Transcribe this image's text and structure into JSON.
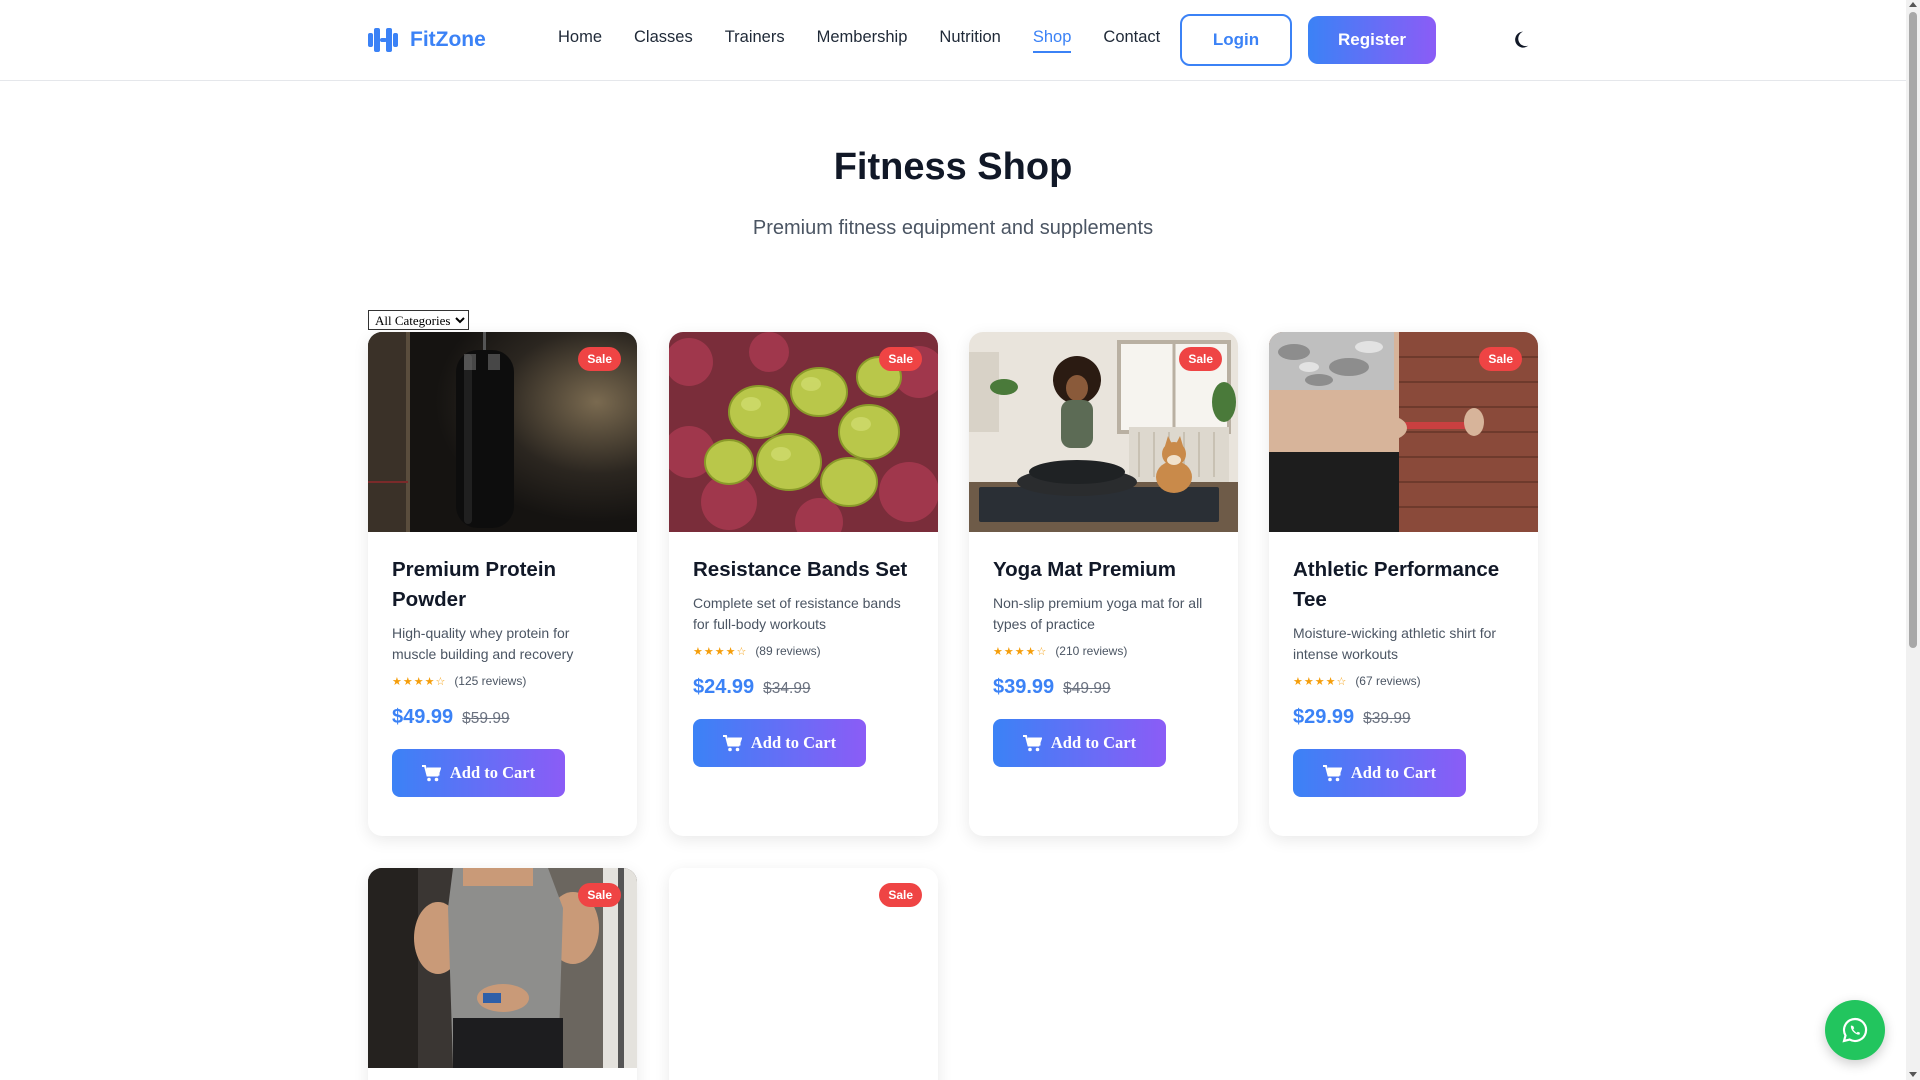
{
  "header": {
    "logo_text": "FitZone",
    "nav": [
      {
        "label": "Home",
        "active": false
      },
      {
        "label": "Classes",
        "active": false
      },
      {
        "label": "Trainers",
        "active": false
      },
      {
        "label": "Membership",
        "active": false
      },
      {
        "label": "Nutrition",
        "active": false
      },
      {
        "label": "Shop",
        "active": true
      },
      {
        "label": "Contact",
        "active": false
      }
    ],
    "login_label": "Login",
    "register_label": "Register"
  },
  "hero": {
    "title": "Fitness Shop",
    "subtitle": "Premium fitness equipment and supplements"
  },
  "filter": {
    "selected": "All Categories"
  },
  "products": [
    {
      "name": "Premium Protein Powder",
      "description": "High-quality whey protein for muscle building and recovery",
      "stars": "★★★★☆",
      "reviews": "(125 reviews)",
      "price": "$49.99",
      "old_price": "$59.99",
      "badge": "Sale",
      "cta": "Add to Cart"
    },
    {
      "name": "Resistance Bands Set",
      "description": "Complete set of resistance bands for full-body workouts",
      "stars": "★★★★☆",
      "reviews": "(89 reviews)",
      "price": "$24.99",
      "old_price": "$34.99",
      "badge": "Sale",
      "cta": "Add to Cart"
    },
    {
      "name": "Yoga Mat Premium",
      "description": "Non-slip premium yoga mat for all types of practice",
      "stars": "★★★★☆",
      "reviews": "(210 reviews)",
      "price": "$39.99",
      "old_price": "$49.99",
      "badge": "Sale",
      "cta": "Add to Cart"
    },
    {
      "name": "Athletic Performance Tee",
      "description": "Moisture-wicking athletic shirt for intense workouts",
      "stars": "★★★★☆",
      "reviews": "(67 reviews)",
      "price": "$29.99",
      "old_price": "$39.99",
      "badge": "Sale",
      "cta": "Add to Cart"
    },
    {
      "badge": "Sale"
    },
    {
      "badge": "Sale"
    }
  ],
  "colors": {
    "primary": "#3b82f6",
    "accent": "#8b5cf6",
    "sale": "#ef4444",
    "whatsapp": "#22c55e"
  }
}
